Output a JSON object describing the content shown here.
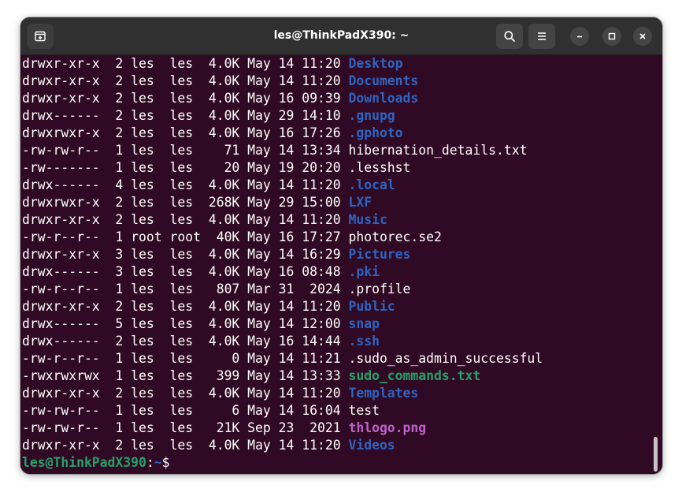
{
  "window": {
    "title": "les@ThinkPadX390: ~"
  },
  "header_buttons": {
    "new_tab": "new-tab-icon",
    "search": "search-icon",
    "menu": "hamburger-menu-icon",
    "minimize": "minimize-icon",
    "maximize": "maximize-icon",
    "close": "close-icon"
  },
  "colors": {
    "terminal_bg": "#300a24",
    "directory": "#2f64c0",
    "executable": "#26a269",
    "image": "#c061cb",
    "text": "#ffffff"
  },
  "listing": [
    {
      "perms": "drwxr-xr-x",
      "links": "2",
      "owner": "les ",
      "group": "les ",
      "size": "4.0K",
      "month": "May",
      "day": "14",
      "time": "11:20",
      "name": "Desktop",
      "type": "dir"
    },
    {
      "perms": "drwxr-xr-x",
      "links": "2",
      "owner": "les ",
      "group": "les ",
      "size": "4.0K",
      "month": "May",
      "day": "14",
      "time": "11:20",
      "name": "Documents",
      "type": "dir"
    },
    {
      "perms": "drwxr-xr-x",
      "links": "2",
      "owner": "les ",
      "group": "les ",
      "size": "4.0K",
      "month": "May",
      "day": "16",
      "time": "09:39",
      "name": "Downloads",
      "type": "dir"
    },
    {
      "perms": "drwx------",
      "links": "2",
      "owner": "les ",
      "group": "les ",
      "size": "4.0K",
      "month": "May",
      "day": "29",
      "time": "14:10",
      "name": ".gnupg",
      "type": "dir"
    },
    {
      "perms": "drwxrwxr-x",
      "links": "2",
      "owner": "les ",
      "group": "les ",
      "size": "4.0K",
      "month": "May",
      "day": "16",
      "time": "17:26",
      "name": ".gphoto",
      "type": "dir"
    },
    {
      "perms": "-rw-rw-r--",
      "links": "1",
      "owner": "les ",
      "group": "les ",
      "size": "71",
      "month": "May",
      "day": "14",
      "time": "13:34",
      "name": "hibernation_details.txt",
      "type": "plain"
    },
    {
      "perms": "-rw-------",
      "links": "1",
      "owner": "les ",
      "group": "les ",
      "size": "20",
      "month": "May",
      "day": "19",
      "time": "20:20",
      "name": ".lesshst",
      "type": "plain"
    },
    {
      "perms": "drwx------",
      "links": "4",
      "owner": "les ",
      "group": "les ",
      "size": "4.0K",
      "month": "May",
      "day": "14",
      "time": "11:20",
      "name": ".local",
      "type": "dir"
    },
    {
      "perms": "drwxrwxr-x",
      "links": "2",
      "owner": "les ",
      "group": "les ",
      "size": "268K",
      "month": "May",
      "day": "29",
      "time": "15:00",
      "name": "LXF",
      "type": "dir"
    },
    {
      "perms": "drwxr-xr-x",
      "links": "2",
      "owner": "les ",
      "group": "les ",
      "size": "4.0K",
      "month": "May",
      "day": "14",
      "time": "11:20",
      "name": "Music",
      "type": "dir"
    },
    {
      "perms": "-rw-r--r--",
      "links": "1",
      "owner": "root",
      "group": "root",
      "size": "40K",
      "month": "May",
      "day": "16",
      "time": "17:27",
      "name": "photorec.se2",
      "type": "plain"
    },
    {
      "perms": "drwxr-xr-x",
      "links": "3",
      "owner": "les ",
      "group": "les ",
      "size": "4.0K",
      "month": "May",
      "day": "14",
      "time": "16:29",
      "name": "Pictures",
      "type": "dir"
    },
    {
      "perms": "drwx------",
      "links": "3",
      "owner": "les ",
      "group": "les ",
      "size": "4.0K",
      "month": "May",
      "day": "16",
      "time": "08:48",
      "name": ".pki",
      "type": "dir"
    },
    {
      "perms": "-rw-r--r--",
      "links": "1",
      "owner": "les ",
      "group": "les ",
      "size": "807",
      "month": "Mar",
      "day": "31",
      "time": " 2024",
      "name": ".profile",
      "type": "plain"
    },
    {
      "perms": "drwxr-xr-x",
      "links": "2",
      "owner": "les ",
      "group": "les ",
      "size": "4.0K",
      "month": "May",
      "day": "14",
      "time": "11:20",
      "name": "Public",
      "type": "dir"
    },
    {
      "perms": "drwx------",
      "links": "5",
      "owner": "les ",
      "group": "les ",
      "size": "4.0K",
      "month": "May",
      "day": "14",
      "time": "12:00",
      "name": "snap",
      "type": "dir"
    },
    {
      "perms": "drwx------",
      "links": "2",
      "owner": "les ",
      "group": "les ",
      "size": "4.0K",
      "month": "May",
      "day": "16",
      "time": "14:44",
      "name": ".ssh",
      "type": "dir"
    },
    {
      "perms": "-rw-r--r--",
      "links": "1",
      "owner": "les ",
      "group": "les ",
      "size": "0",
      "month": "May",
      "day": "14",
      "time": "11:21",
      "name": ".sudo_as_admin_successful",
      "type": "plain"
    },
    {
      "perms": "-rwxrwxrwx",
      "links": "1",
      "owner": "les ",
      "group": "les ",
      "size": "399",
      "month": "May",
      "day": "14",
      "time": "13:33",
      "name": "sudo_commands.txt",
      "type": "exe"
    },
    {
      "perms": "drwxr-xr-x",
      "links": "2",
      "owner": "les ",
      "group": "les ",
      "size": "4.0K",
      "month": "May",
      "day": "14",
      "time": "11:20",
      "name": "Templates",
      "type": "dir"
    },
    {
      "perms": "-rw-rw-r--",
      "links": "1",
      "owner": "les ",
      "group": "les ",
      "size": "6",
      "month": "May",
      "day": "14",
      "time": "16:04",
      "name": "test",
      "type": "plain"
    },
    {
      "perms": "-rw-rw-r--",
      "links": "1",
      "owner": "les ",
      "group": "les ",
      "size": "21K",
      "month": "Sep",
      "day": "23",
      "time": " 2021",
      "name": "thlogo.png",
      "type": "img"
    },
    {
      "perms": "drwxr-xr-x",
      "links": "2",
      "owner": "les ",
      "group": "les ",
      "size": "4.0K",
      "month": "May",
      "day": "14",
      "time": "11:20",
      "name": "Videos",
      "type": "dir"
    }
  ],
  "prompt": {
    "user_host": "les@ThinkPadX390",
    "separator": ":",
    "path": "~",
    "symbol": "$"
  }
}
